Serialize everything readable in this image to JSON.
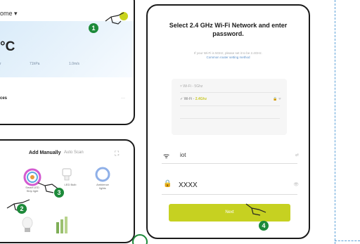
{
  "home": {
    "title": "ome ▾",
    "temperature": "°C",
    "stats": [
      "r",
      "71hPa",
      "1.0m/s"
    ],
    "devices_label": "ces",
    "devices_more": "···"
  },
  "add_device": {
    "tab_manual": "Add Manually",
    "tab_auto": "Auto Scan",
    "devices": [
      "Smart LED\nStrip light",
      "LED Bulb",
      "Ambience\nlights"
    ]
  },
  "wifi": {
    "title": "Select 2.4 GHz Wi-Fi Network and enter password.",
    "note": "If your Wi-Fi is 5GHz, please set it to be 2.4GHz.",
    "note_link": "Common router setting method",
    "network_5g": "× Wi-Fi - 5Ghz",
    "network_24g_prefix": "✓ Wi-Fi - ",
    "network_24g_band": "2.4Ghz",
    "ssid_value": "iot",
    "password_value": "XXXX",
    "next_label": "Next"
  },
  "steps": [
    "1",
    "2",
    "3",
    "4"
  ],
  "colors": {
    "accent": "#c6d121",
    "badge": "#1d8a3a",
    "dashed": "#5aa0d8"
  }
}
